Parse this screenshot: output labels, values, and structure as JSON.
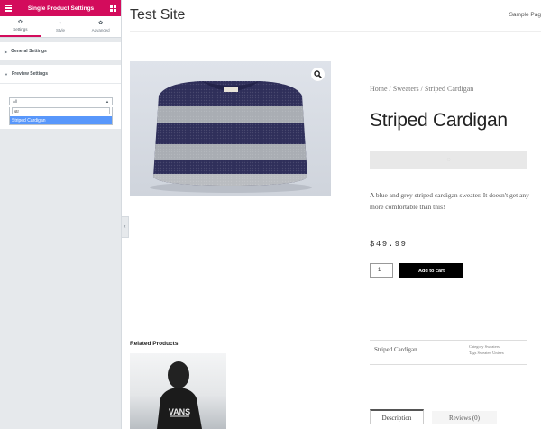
{
  "editor": {
    "title": "Single Product Settings",
    "tabs": [
      {
        "label": "Settings",
        "icon": "gear-icon"
      },
      {
        "label": "Style",
        "icon": "contrast-icon"
      },
      {
        "label": "Advanced",
        "icon": "gear-icon"
      }
    ],
    "sections": {
      "general": "General Settings",
      "preview": "Preview Settings"
    },
    "preview_select": {
      "value": "All",
      "search_value": "str",
      "options": [
        "Striped Cardigan"
      ]
    },
    "accent_color": "#d30c5c"
  },
  "site": {
    "title": "Test Site",
    "nav_item": "Sample Pag"
  },
  "product": {
    "breadcrumb": "Home / Sweaters / Striped Cardigan",
    "title": "Striped Cardigan",
    "description": "A blue and grey striped cardigan sweater. It doesn't get any more comfortable than this!",
    "price": "$49.99",
    "quantity": "1",
    "add_to_cart": "Add to cart",
    "meta_name": "Striped Cardigan",
    "meta_category": "Category Sweaters",
    "meta_tags": "Tags Sweater, Unisex",
    "tabs": [
      "Description",
      "Reviews (0)"
    ]
  },
  "related": {
    "title": "Related Products",
    "hoodie_text": "VANS"
  }
}
